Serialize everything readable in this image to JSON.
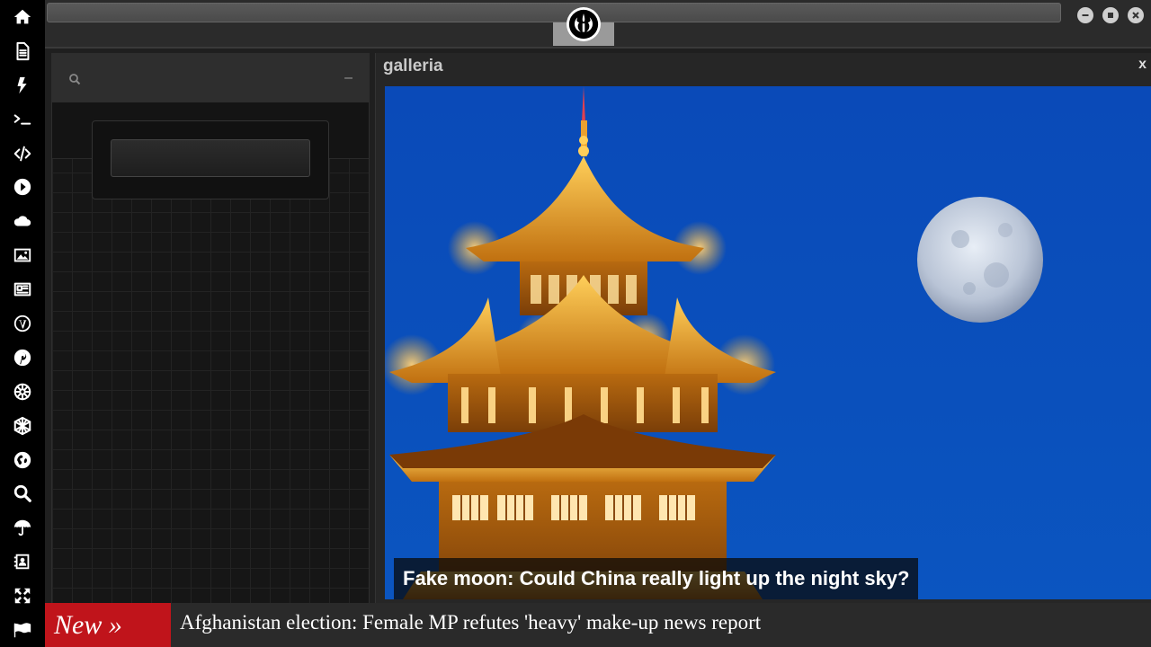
{
  "dock": {
    "items": [
      {
        "icon": "home-icon"
      },
      {
        "icon": "document-icon"
      },
      {
        "icon": "lightning-icon"
      },
      {
        "icon": "terminal-icon"
      },
      {
        "icon": "code-icon"
      },
      {
        "icon": "play-icon"
      },
      {
        "icon": "cloud-icon"
      },
      {
        "icon": "image-icon"
      },
      {
        "icon": "newspaper-icon"
      },
      {
        "icon": "wordpress-icon"
      },
      {
        "icon": "pinterest-icon"
      },
      {
        "icon": "galactic-empire-icon"
      },
      {
        "icon": "network-sphere-icon"
      },
      {
        "icon": "globe-icon"
      },
      {
        "icon": "search-icon"
      },
      {
        "icon": "umbrella-icon"
      },
      {
        "icon": "contact-card-icon"
      },
      {
        "icon": "expand-icon"
      },
      {
        "icon": "flag-icon"
      }
    ]
  },
  "topbar": {
    "emblem_icon": "rebel-alliance-icon",
    "window_controls": [
      "minimize-icon",
      "maximize-icon",
      "close-icon"
    ]
  },
  "left_panel": {
    "minimize_label": "–"
  },
  "gallery": {
    "title": "galleria",
    "close_label": "x",
    "caption": "Fake moon: Could China really light up the night sky?"
  },
  "ticker": {
    "badge": "New »",
    "headline": "Afghanistan election: Female MP refutes 'heavy' make-up news report"
  },
  "colors": {
    "dock_bg": "#000000",
    "ticker_badge": "#c0141b",
    "sky_blue": "#0a4ab8",
    "pagoda_gold": "#f0a020"
  }
}
